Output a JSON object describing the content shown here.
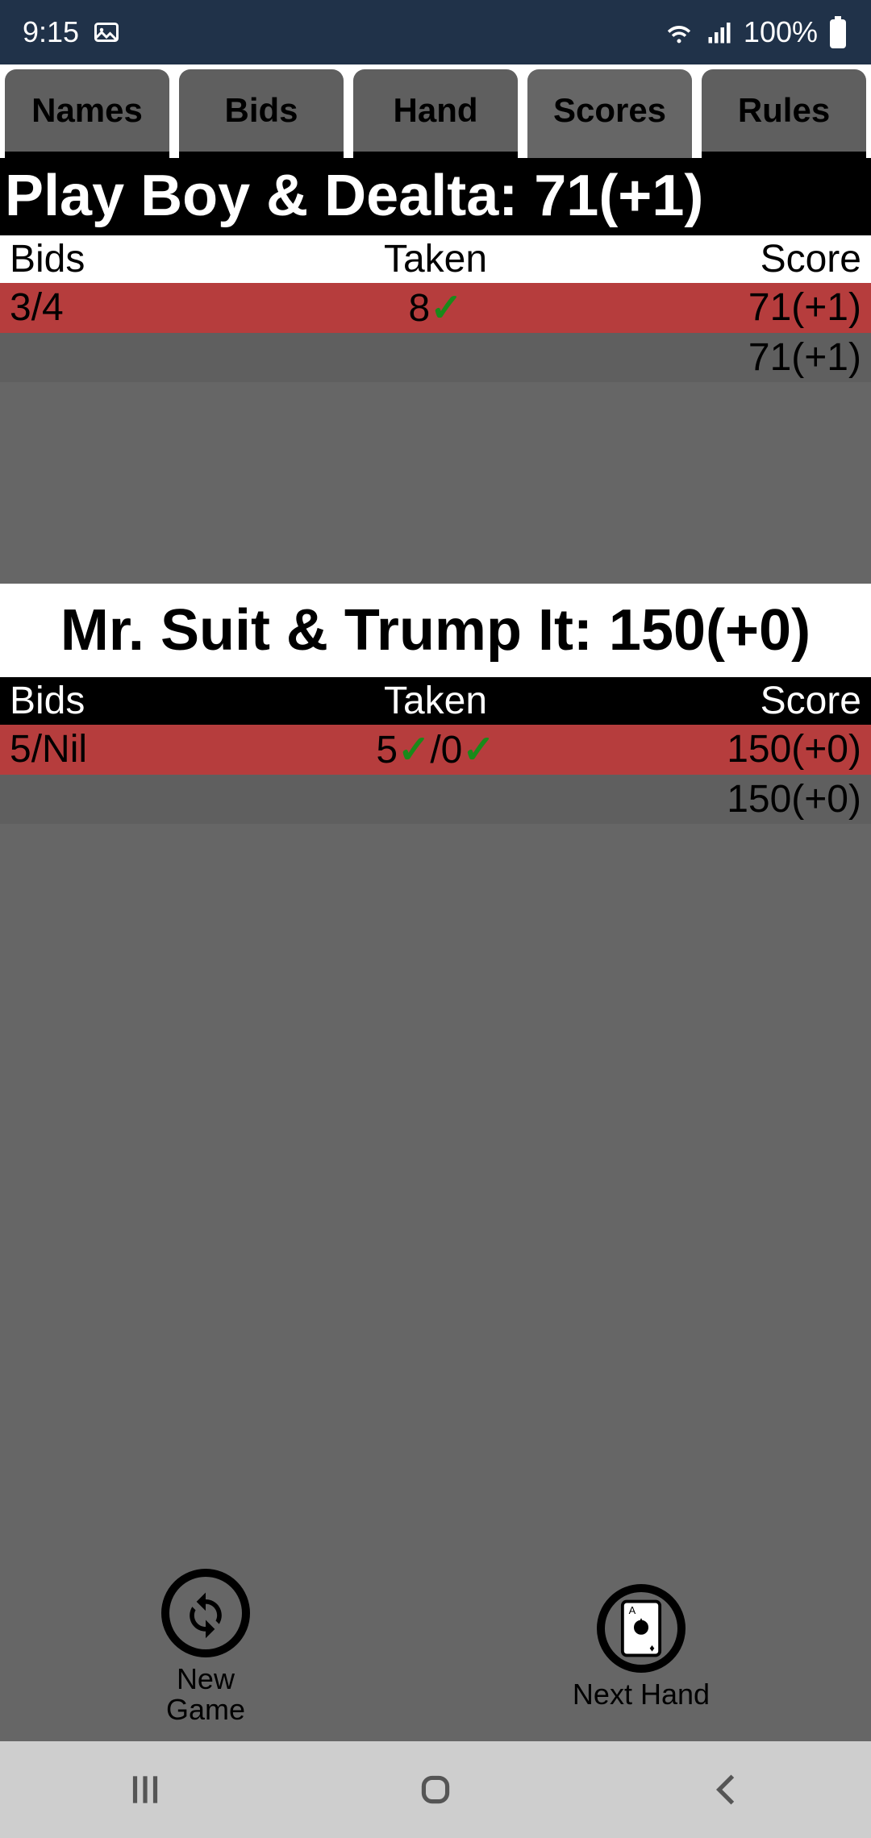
{
  "status": {
    "time": "9:15",
    "battery_pct": "100%"
  },
  "tabs": {
    "names": "Names",
    "bids": "Bids",
    "hand": "Hand",
    "scores": "Scores",
    "rules": "Rules"
  },
  "columns": {
    "bids": "Bids",
    "taken": "Taken",
    "score": "Score"
  },
  "team1": {
    "header": "Play Boy & Dealta: 71(+1)",
    "rows": [
      {
        "bids": "3/4",
        "taken_pre": "8",
        "taken_check1": "✓",
        "taken_mid": "",
        "taken_check2": "",
        "score": "71(+1)"
      }
    ],
    "total": "71(+1)"
  },
  "team2": {
    "header": "Mr. Suit & Trump It: 150(+0)",
    "rows": [
      {
        "bids": "5/Nil",
        "taken_pre": "5",
        "taken_check1": "✓",
        "taken_mid": "/0",
        "taken_check2": "✓",
        "score": "150(+0)"
      }
    ],
    "total": "150(+0)"
  },
  "buttons": {
    "new_game": "New\nGame",
    "next_hand": "Next Hand"
  }
}
